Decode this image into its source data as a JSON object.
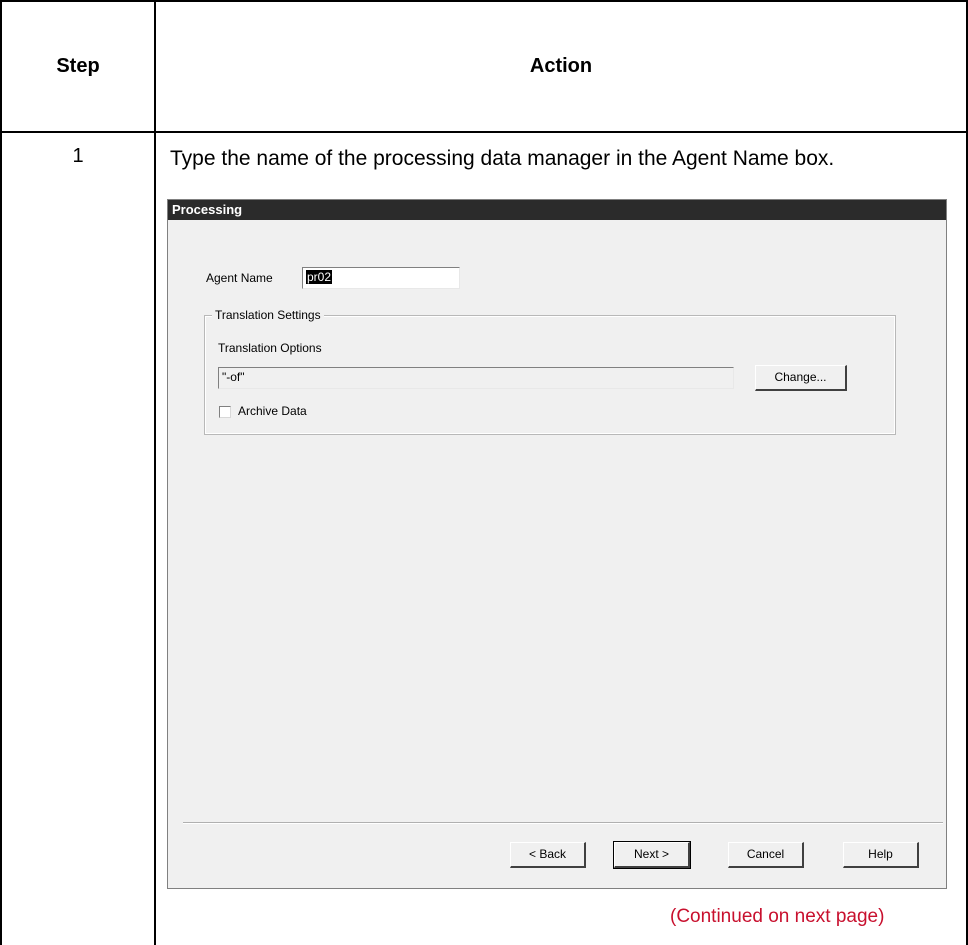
{
  "table": {
    "headers": {
      "step": "Step",
      "action": "Action"
    },
    "rows": [
      {
        "step": "1",
        "instruction": "Type the name of the processing data manager in the Agent Name box."
      }
    ],
    "continued": "(Continued on next page)"
  },
  "dialog": {
    "title": "Processing",
    "agent_name_label": "Agent Name",
    "agent_name_value": "pr02",
    "translation_settings_legend": "Translation Settings",
    "translation_options_label": "Translation Options",
    "translation_options_value": "\"-of\"",
    "change_button": "Change...",
    "archive_data_label": "Archive Data",
    "archive_data_checked": false,
    "buttons": {
      "back": "< Back",
      "next": "Next >",
      "cancel": "Cancel",
      "help": "Help"
    }
  }
}
